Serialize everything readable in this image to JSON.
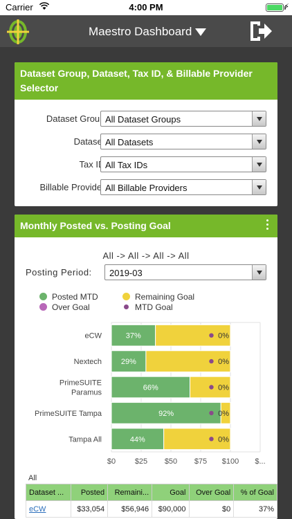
{
  "status_bar": {
    "carrier": "Carrier",
    "time": "4:00 PM"
  },
  "nav": {
    "title": "Maestro Dashboard"
  },
  "selector_card": {
    "header": "Dataset Group, Dataset, Tax ID, & Billable Provider Selector",
    "rows": [
      {
        "label": "Dataset Group:",
        "value": "All Dataset Groups"
      },
      {
        "label": "Dataset:",
        "value": "All Datasets"
      },
      {
        "label": "Tax ID:",
        "value": "All Tax IDs"
      },
      {
        "label": "Billable Provider:",
        "value": "All Billable Providers"
      }
    ]
  },
  "goal_card": {
    "header": "Monthly Posted vs. Posting Goal",
    "path": "All -> All -> All -> All",
    "period_label": "Posting Period:",
    "period_value": "2019-03",
    "legend": [
      {
        "label": "Posted MTD",
        "color": "#6cb36c"
      },
      {
        "label": "Remaining Goal",
        "color": "#f0d23c"
      },
      {
        "label": "Over Goal",
        "color": "#b867b8"
      },
      {
        "label": "MTD Goal",
        "color": "#8a4a8a"
      }
    ],
    "table_caption": "All",
    "table": {
      "headers": [
        "Dataset ...",
        "Posted",
        "Remaini...",
        "Goal",
        "Over Goal",
        "% of Goal"
      ],
      "rows": [
        [
          "eCW",
          "$33,054",
          "$56,946",
          "$90,000",
          "$0",
          "37%"
        ]
      ]
    }
  },
  "chart_data": {
    "type": "bar",
    "orientation": "horizontal",
    "stacked": true,
    "categories": [
      "eCW",
      "Nextech",
      "PrimeSUITE Paramus",
      "PrimeSUITE Tampa",
      "Tampa All"
    ],
    "series": [
      {
        "name": "Posted MTD",
        "values": [
          37,
          29,
          66,
          92,
          44
        ],
        "labels": [
          "37%",
          "29%",
          "66%",
          "92%",
          "44%"
        ],
        "color": "#6cb36c"
      },
      {
        "name": "Remaining Goal",
        "values": [
          63,
          71,
          34,
          8,
          56
        ],
        "color": "#f0d23c"
      },
      {
        "name": "Over Goal",
        "values": [
          0,
          0,
          0,
          0,
          0
        ],
        "labels": [
          "0%",
          "0%",
          "0%",
          "0%",
          "0%"
        ],
        "color": "#b867b8"
      }
    ],
    "mtd_goal": [
      84,
      84,
      84,
      84,
      84
    ],
    "mtd_goal_color": "#8a4a8a",
    "xlim": [
      0,
      125
    ],
    "x_ticks": [
      "$0",
      "$25",
      "$50",
      "$75",
      "$100",
      "$..."
    ],
    "x_tick_values": [
      0,
      25,
      50,
      75,
      100,
      125
    ],
    "grid": true
  }
}
